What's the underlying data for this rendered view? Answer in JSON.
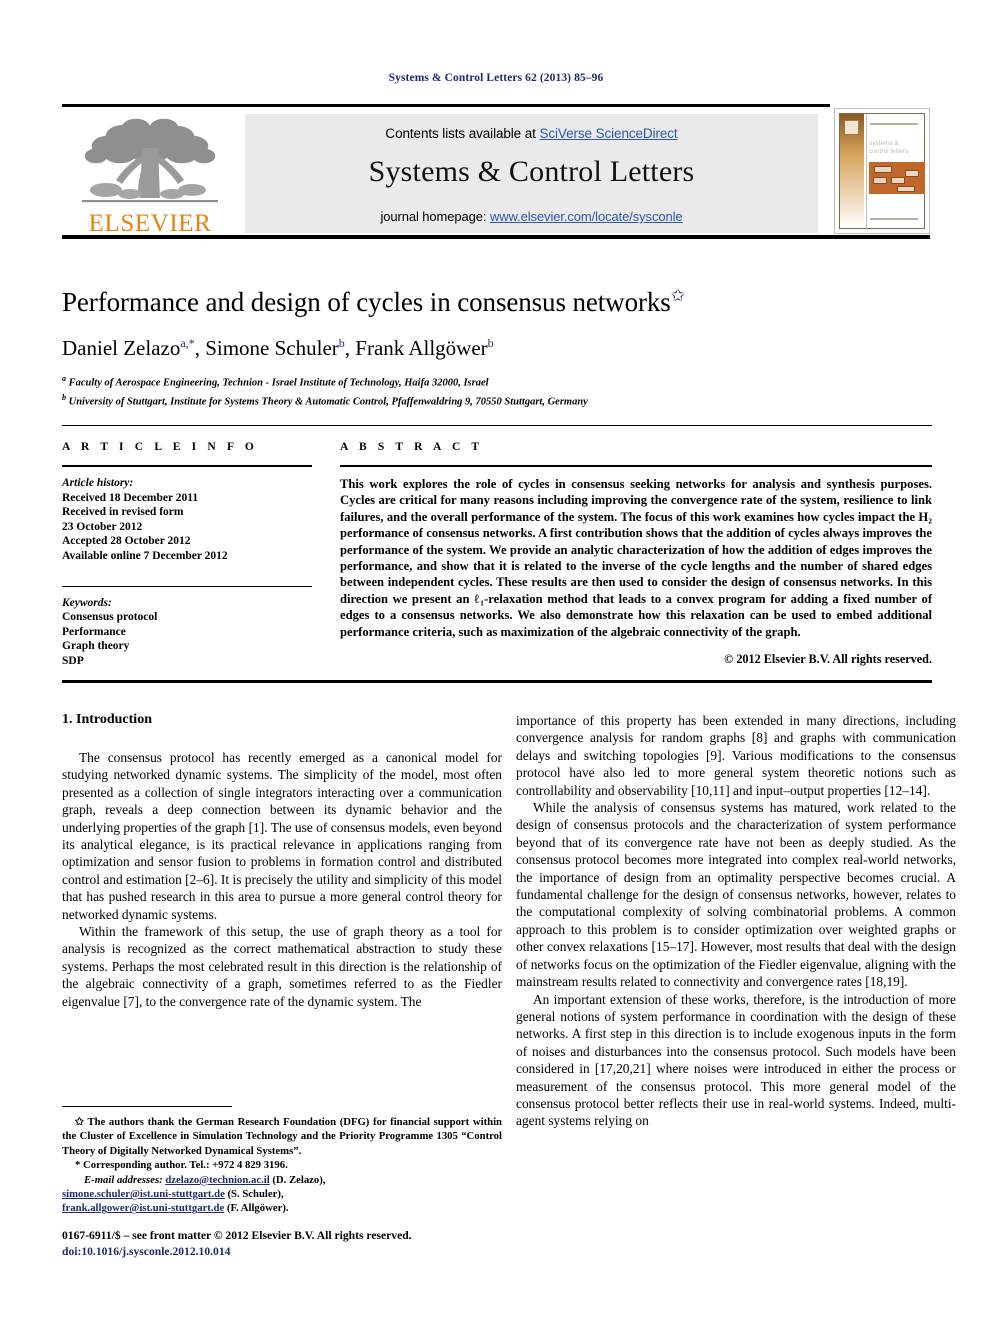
{
  "running_head": "Systems & Control Letters 62 (2013) 85–96",
  "header": {
    "contents_prefix": "Contents lists available at ",
    "contents_link": "SciVerse ScienceDirect",
    "journal_title": "Systems & Control Letters",
    "homepage_prefix": "journal homepage: ",
    "homepage_link": "www.elsevier.com/locate/sysconle",
    "publisher_wordmark": "ELSEVIER",
    "cover_title_line1": "systems &",
    "cover_title_line2": "control letters",
    "accent_orange": "#e8820c",
    "link_blue": "#2f57a8",
    "box_gray": "#eaeaea"
  },
  "title": {
    "text": "Performance and design of cycles in consensus networks",
    "footnote_marker": "✩"
  },
  "authors": {
    "a1_name": "Daniel Zelazo",
    "a1_sup": "a,",
    "a1_star": "*",
    "sep1": ", ",
    "a2_name": "Simone Schuler",
    "a2_sup": "b",
    "sep2": ", ",
    "a3_name": "Frank Allgöwer",
    "a3_sup": "b"
  },
  "affiliations": [
    {
      "marker": "a",
      "text": "Faculty of Aerospace Engineering, Technion - Israel Institute of Technology, Haifa 32000, Israel"
    },
    {
      "marker": "b",
      "text": "University of Stuttgart, Institute for Systems Theory & Automatic Control, Pfaffenwaldring 9, 70550 Stuttgart, Germany"
    }
  ],
  "article_info": {
    "heading": "A R T I C L E   I N F O",
    "history_label": "Article history:",
    "history": [
      "Received 18 December 2011",
      "Received in revised form",
      "23 October 2012",
      "Accepted 28 October 2012",
      "Available online 7 December 2012"
    ],
    "keywords_label": "Keywords:",
    "keywords": [
      "Consensus protocol",
      "Performance",
      "Graph theory",
      "SDP"
    ]
  },
  "abstract": {
    "heading": "A B S T R A C T",
    "part1": "This work explores the role of cycles in consensus seeking networks for analysis and synthesis purposes. Cycles are critical for many reasons including improving the convergence rate of the system, resilience to link failures, and the overall performance of the system. The focus of this work examines how cycles impact the ",
    "math_h2": "H₂",
    "part2": " performance of consensus networks. A first contribution shows that the addition of cycles always improves the performance of the system. We provide an analytic characterization of how the addition of edges improves the performance, and show that it is related to the inverse of the cycle lengths and the number of shared edges between independent cycles. These results are then used to consider the design of consensus networks. In this direction we present an ",
    "math_l1": "ℓ₁",
    "part3": "-relaxation method that leads to a convex program for adding a fixed number of edges to a consensus networks. We also demonstrate how this relaxation can be used to embed additional performance criteria, such as maximization of the algebraic connectivity of the graph.",
    "copyright": "© 2012 Elsevier B.V. All rights reserved."
  },
  "body": {
    "section_heading": "1.  Introduction",
    "left_paragraphs": [
      "The consensus protocol has recently emerged as a canonical model for studying networked dynamic systems. The simplicity of the model, most often presented as a collection of single integrators interacting over a communication graph, reveals a deep connection between its dynamic behavior and the underlying properties of the graph [1]. The use of consensus models, even beyond its analytical elegance, is its practical relevance in applications ranging from optimization and sensor fusion to problems in formation control and distributed control and estimation [2–6]. It is precisely the utility and simplicity of this model that has pushed research in this area to pursue a more general control theory for networked dynamic systems.",
      "Within the framework of this setup, the use of graph theory as a tool for analysis is recognized as the correct mathematical abstraction to study these systems. Perhaps the most celebrated result in this direction is the relationship of the algebraic connectivity of a graph, sometimes referred to as the Fiedler eigenvalue [7], to the convergence rate of the dynamic system. The"
    ],
    "right_paragraphs": [
      "importance of this property has been extended in many directions, including convergence analysis for random graphs [8] and graphs with communication delays and switching topologies [9]. Various modifications to the consensus protocol have also led to more general system theoretic notions such as controllability and observability [10,11] and input–output properties [12–14].",
      "While the analysis of consensus systems has matured, work related to the design of consensus protocols and the characterization of system performance beyond that of its convergence rate have not been as deeply studied. As the consensus protocol becomes more integrated into complex real-world networks, the importance of design from an optimality perspective becomes crucial. A fundamental challenge for the design of consensus networks, however, relates to the computational complexity of solving combinatorial problems. A common approach to this problem is to consider optimization over weighted graphs or other convex relaxations [15–17]. However, most results that deal with the design of networks focus on the optimization of the Fiedler eigenvalue, aligning with the mainstream results related to connectivity and convergence rates [18,19].",
      "An important extension of these works, therefore, is the introduction of more general notions of system performance in coordination with the design of these networks. A first step in this direction is to include exogenous inputs in the form of noises and disturbances into the consensus protocol. Such models have been considered in [17,20,21] where noises were introduced in either the process or measurement of the consensus protocol. This more general model of the consensus protocol better reflects their use in real-world systems. Indeed, multi-agent systems relying on"
    ]
  },
  "footnotes": {
    "acknowledgement_marker": "✩",
    "acknowledgement": "The authors thank the German Research Foundation (DFG) for financial support within the Cluster of Excellence in Simulation Technology and the Priority Programme 1305 “Control Theory of Digitally Networked Dynamical Systems”.",
    "corresponding_marker": "*",
    "corresponding": "Corresponding author. Tel.: +972 4 829 3196.",
    "email_label": "E-mail addresses:",
    "emails": [
      {
        "address": "dzelazo@technion.ac.il",
        "owner": " (D. Zelazo),"
      },
      {
        "address": "simone.schuler@ist.uni-stuttgart.de",
        "owner": " (S. Schuler),"
      },
      {
        "address": "frank.allgower@ist.uni-stuttgart.de",
        "owner": " (F. Allgöwer)."
      }
    ]
  },
  "imprint": {
    "line1": "0167-6911/$ – see front matter © 2012 Elsevier B.V. All rights reserved.",
    "doi": "doi:10.1016/j.sysconle.2012.10.014"
  }
}
